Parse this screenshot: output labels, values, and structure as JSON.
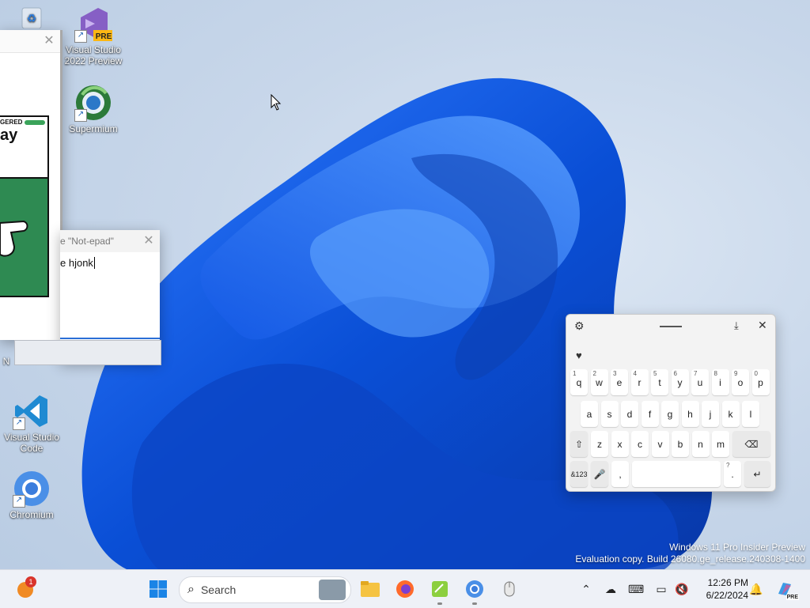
{
  "desktop": {
    "icons": [
      {
        "label": "Recycle Bin",
        "icon": "recycle-bin-icon"
      },
      {
        "label": "Visual Studio 2022 Preview",
        "line1": "Visual Studio",
        "line2": "2022 Preview",
        "badge": "PRE",
        "icon": "visual-studio-icon"
      },
      {
        "label": "Supermium",
        "icon": "supermium-icon"
      },
      {
        "label": "Visual Studio Code",
        "line1": "Visual Studio",
        "line2": "Code",
        "icon": "vscode-icon"
      },
      {
        "label": "Chromium",
        "icon": "chromium-icon"
      }
    ],
    "partial_label": "N"
  },
  "comic_window": {
    "banner": "GERED",
    "speech_text": "ay"
  },
  "notepad": {
    "title": "e \"Not-epad\"",
    "text": "e hjonk"
  },
  "watermark": {
    "line1": "Windows 11 Pro Insider Preview",
    "line2": "Evaluation copy. Build 26080.ge_release.240308-1400"
  },
  "keyboard": {
    "rows": [
      [
        {
          "k": "q",
          "s": "1"
        },
        {
          "k": "w",
          "s": "2"
        },
        {
          "k": "e",
          "s": "3"
        },
        {
          "k": "r",
          "s": "4"
        },
        {
          "k": "t",
          "s": "5"
        },
        {
          "k": "y",
          "s": "6"
        },
        {
          "k": "u",
          "s": "7"
        },
        {
          "k": "i",
          "s": "8"
        },
        {
          "k": "o",
          "s": "9"
        },
        {
          "k": "p",
          "s": "0"
        }
      ],
      [
        {
          "k": "a"
        },
        {
          "k": "s"
        },
        {
          "k": "d"
        },
        {
          "k": "f"
        },
        {
          "k": "g"
        },
        {
          "k": "h"
        },
        {
          "k": "j"
        },
        {
          "k": "k"
        },
        {
          "k": "l"
        }
      ],
      [
        {
          "k": "z"
        },
        {
          "k": "x"
        },
        {
          "k": "c"
        },
        {
          "k": "v"
        },
        {
          "k": "b"
        },
        {
          "k": "n"
        },
        {
          "k": "m"
        }
      ]
    ],
    "symbols_label": "&123",
    "comma": ",",
    "period": ".",
    "period_sup": "?"
  },
  "taskbar": {
    "search_placeholder": "Search",
    "notification_count": "1",
    "time": "12:26 PM",
    "date": "6/22/2024",
    "copilot_badge": "PRE"
  },
  "colors": {
    "accent": "#0067c0",
    "bloom_blue": "#1a5fe0"
  }
}
